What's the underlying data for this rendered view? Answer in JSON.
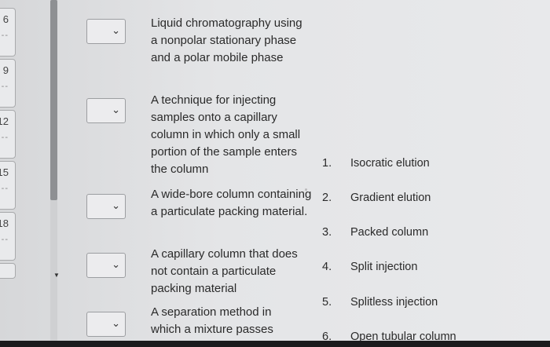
{
  "question_numbers": [
    {
      "label": "6",
      "points": "--"
    },
    {
      "label": "9",
      "points": "--"
    },
    {
      "label": "12",
      "points": "--"
    },
    {
      "label": "15",
      "points": "--"
    },
    {
      "label": "18",
      "points": "--"
    }
  ],
  "matching_items": [
    {
      "description": "Liquid chromatography using a nonpolar stationary phase and a polar mobile phase",
      "selected": ""
    },
    {
      "description": "A technique for injecting samples onto a capillary column in which only a small portion of the sample enters the column",
      "selected": ""
    },
    {
      "description": "A wide-bore column containing a particulate packing material.",
      "selected": ""
    },
    {
      "description": "A capillary column that does not contain a particulate packing material",
      "selected": ""
    },
    {
      "description": "A separation method in which a mixture passes",
      "selected": ""
    }
  ],
  "answer_options": [
    {
      "num": "1.",
      "label": "Isocratic elution"
    },
    {
      "num": "2.",
      "label": "Gradient elution"
    },
    {
      "num": "3.",
      "label": "Packed column"
    },
    {
      "num": "4.",
      "label": "Split injection"
    },
    {
      "num": "5.",
      "label": "Splitless injection"
    },
    {
      "num": "6.",
      "label": "Open tubular column"
    }
  ],
  "icons": {
    "select_chevron": "chevron-down-icon"
  }
}
